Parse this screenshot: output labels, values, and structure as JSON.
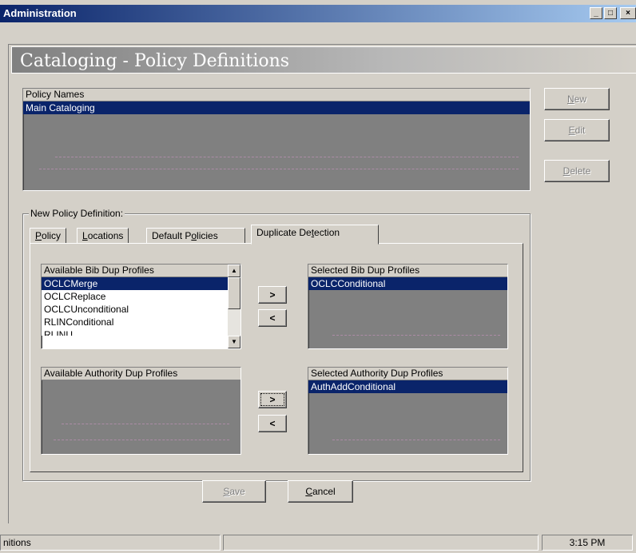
{
  "window": {
    "title": "Administration",
    "controls": {
      "minimize": "_",
      "maximize": "□",
      "close": "×"
    }
  },
  "page_title": "Cataloging - Policy Definitions",
  "policy_names": {
    "header": "Policy Names",
    "items": [
      "Main Cataloging"
    ],
    "selected": "Main Cataloging"
  },
  "side_buttons": {
    "new_pre": "",
    "new_ul": "N",
    "new_post": "ew",
    "edit_pre": "",
    "edit_ul": "E",
    "edit_post": "dit",
    "delete_pre": "",
    "delete_ul": "D",
    "delete_post": "elete"
  },
  "group_label": "New  Policy Definition:",
  "tabs": {
    "policy_ul": "P",
    "policy_post": "olicy",
    "locations_ul": "L",
    "locations_post": "ocations",
    "default_pre": "Default P",
    "default_ul": "o",
    "default_post": "licies",
    "dup_pre": "Duplicate De",
    "dup_ul": "t",
    "dup_post": "ection",
    "active": "Duplicate Detection"
  },
  "available_bib": {
    "header": "Available Bib Dup Profiles",
    "items": [
      "OCLCMerge",
      "OCLCReplace",
      "OCLCUnconditional",
      "RLINConditional",
      "RLINU..."
    ],
    "selected": "OCLCMerge"
  },
  "selected_bib": {
    "header": "Selected Bib Dup Profiles",
    "items": [
      "OCLCConditional"
    ]
  },
  "available_auth": {
    "header": "Available Authority Dup Profiles",
    "items": []
  },
  "selected_auth": {
    "header": "Selected Authority Dup Profiles",
    "items": [
      "AuthAddConditional"
    ]
  },
  "move_buttons": {
    "add": ">",
    "remove": "<"
  },
  "bottom_buttons": {
    "save_ul": "S",
    "save_post": "ave",
    "cancel_ul": "C",
    "cancel_post": "ancel"
  },
  "statusbar": {
    "left": "nitions",
    "time": "3:15 PM"
  }
}
